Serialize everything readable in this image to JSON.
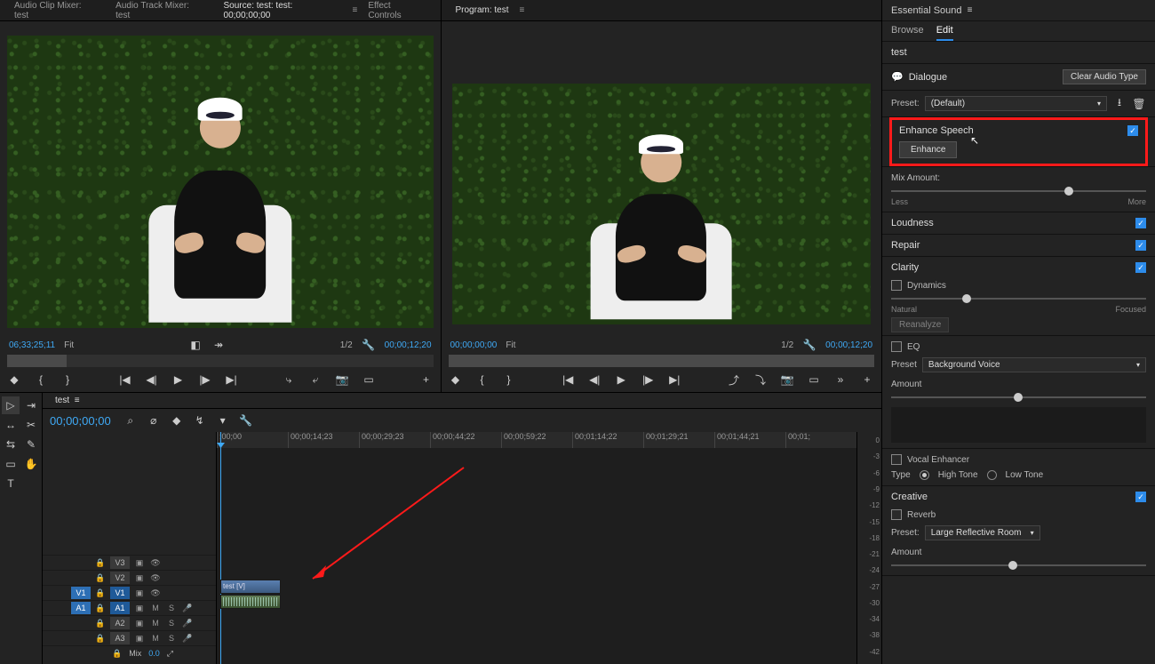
{
  "top_tabs": {
    "audio_clip_mixer": "Audio Clip Mixer: test",
    "audio_track_mixer": "Audio Track Mixer: test",
    "source_label": "Source: test: test: 00;00;00;00",
    "effect_controls": "Effect Controls",
    "program_label": "Program: test"
  },
  "source": {
    "tc": "06;33;25;11",
    "fit": "Fit",
    "fraction": "1/2",
    "duration": "00;00;12;20"
  },
  "program": {
    "tc": "00;00;00;00",
    "fit": "Fit",
    "fraction": "1/2",
    "duration": "00;00;12;20"
  },
  "timeline": {
    "seq_tab": "test",
    "tc": "00;00;00;00",
    "ruler": [
      ":00;00",
      "00;00;14;23",
      "00;00;29;23",
      "00;00;44;22",
      "00;00;59;22",
      "00;01;14;22",
      "00;01;29;21",
      "00;01;44;21",
      "00;01;"
    ],
    "tracks": {
      "v3": "V3",
      "v2": "V2",
      "v1_left": "V1",
      "v1_right": "V1",
      "a1_left": "A1",
      "a1_right": "A1",
      "a2": "A2",
      "a3": "A3",
      "mix": "Mix",
      "mix_val": "0.0",
      "m": "M",
      "s": "S"
    },
    "clip_label": "test [V]"
  },
  "meter_ticks": [
    "0",
    "-3",
    "-6",
    "-9",
    "-12",
    "-15",
    "-18",
    "-21",
    "-24",
    "-27",
    "-30",
    "-34",
    "-38",
    "-42"
  ],
  "panel": {
    "title": "Essential Sound",
    "tab_browse": "Browse",
    "tab_edit": "Edit",
    "clip_name": "test",
    "dialogue": "Dialogue",
    "clear_type": "Clear Audio Type",
    "preset_label": "Preset:",
    "preset_value": "(Default)",
    "enhance_speech": "Enhance Speech",
    "enhance_btn": "Enhance",
    "mix_amount": "Mix Amount:",
    "slider_less": "Less",
    "slider_more": "More",
    "loudness": "Loudness",
    "repair": "Repair",
    "clarity": "Clarity",
    "dynamics": "Dynamics",
    "dyn_natural": "Natural",
    "dyn_focused": "Focused",
    "reanalyze": "Reanalyze",
    "eq": "EQ",
    "eq_preset_label": "Preset",
    "eq_preset_value": "Background Voice",
    "amount": "Amount",
    "vocal_enhancer": "Vocal Enhancer",
    "type": "Type",
    "high_tone": "High Tone",
    "low_tone": "Low Tone",
    "creative": "Creative",
    "reverb": "Reverb",
    "rv_preset_label": "Preset:",
    "rv_preset_value": "Large Reflective Room",
    "rv_amount": "Amount"
  }
}
